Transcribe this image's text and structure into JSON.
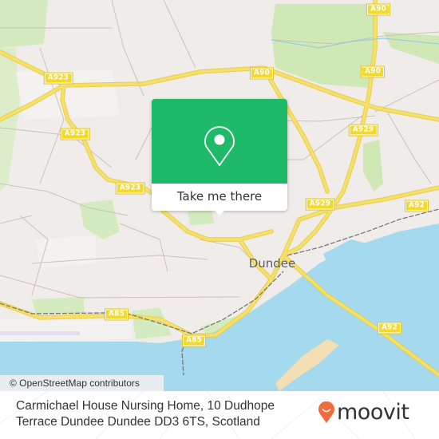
{
  "map": {
    "colors": {
      "land": "#f0ecea",
      "water": "#a5d9ed",
      "park": "#cfe8b5",
      "major_road": "#f6e06a",
      "road_label_bg": "#f2da2a",
      "sand": "#f2dfb4"
    },
    "place_labels": [
      {
        "id": "dundee",
        "text": "Dundee"
      }
    ],
    "road_labels": [
      {
        "id": "a923-1",
        "text": "A923"
      },
      {
        "id": "a923-2",
        "text": "A923"
      },
      {
        "id": "a923-3",
        "text": "A923"
      },
      {
        "id": "a90-1",
        "text": "A90"
      },
      {
        "id": "a90-2",
        "text": "A90"
      },
      {
        "id": "a90-3",
        "text": "A90"
      },
      {
        "id": "a929-1",
        "text": "A929"
      },
      {
        "id": "a929-2",
        "text": "A929"
      },
      {
        "id": "a92-1",
        "text": "A92"
      },
      {
        "id": "a92-2",
        "text": "A92"
      },
      {
        "id": "a85-1",
        "text": "A85"
      },
      {
        "id": "a85-2",
        "text": "A85"
      }
    ],
    "attribution": "© OpenStreetMap contributors"
  },
  "popup": {
    "icon": "map-pin-icon",
    "button_label": "Take me there",
    "accent_color": "#1fb96a"
  },
  "footer": {
    "address": "Carmichael House Nursing Home, 10 Dudhope Terrace Dundee Dundee DD3 6TS, Scotland",
    "brand": "moovit",
    "brand_color": "#f26b3a"
  }
}
